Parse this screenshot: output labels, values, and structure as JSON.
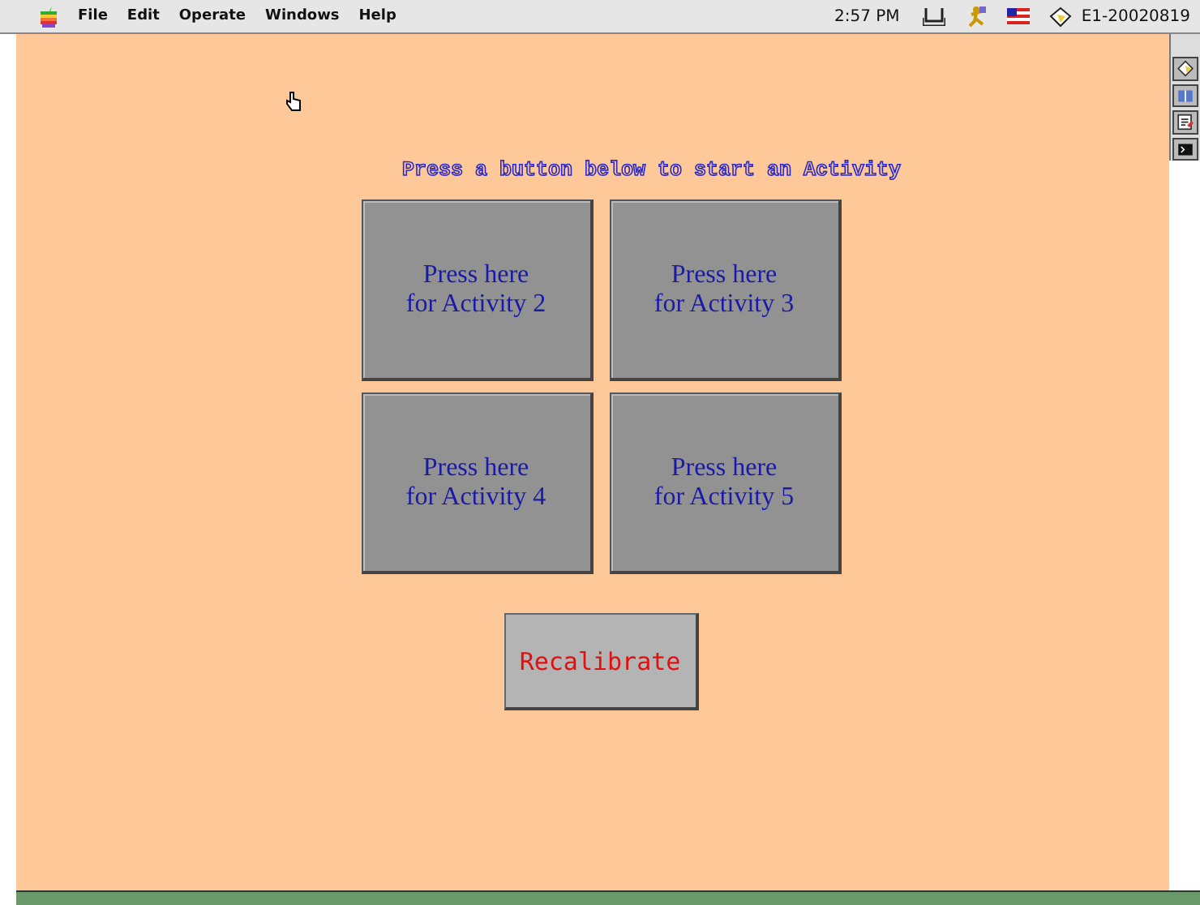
{
  "menu_bar": {
    "menus": [
      "File",
      "Edit",
      "Operate",
      "Windows",
      "Help"
    ],
    "clock": "2:57 PM",
    "app_name": "E1-20020819"
  },
  "heading": "Press a button below to start an Activity",
  "activity_buttons": [
    {
      "lines": [
        "Press here",
        "for Activity 2"
      ]
    },
    {
      "lines": [
        "Press here",
        "for Activity 3"
      ]
    },
    {
      "lines": [
        "Press here",
        "for Activity 4"
      ]
    },
    {
      "lines": [
        "Press here",
        "for Activity 5"
      ]
    }
  ],
  "recalibrate_button": "Recalibrate"
}
